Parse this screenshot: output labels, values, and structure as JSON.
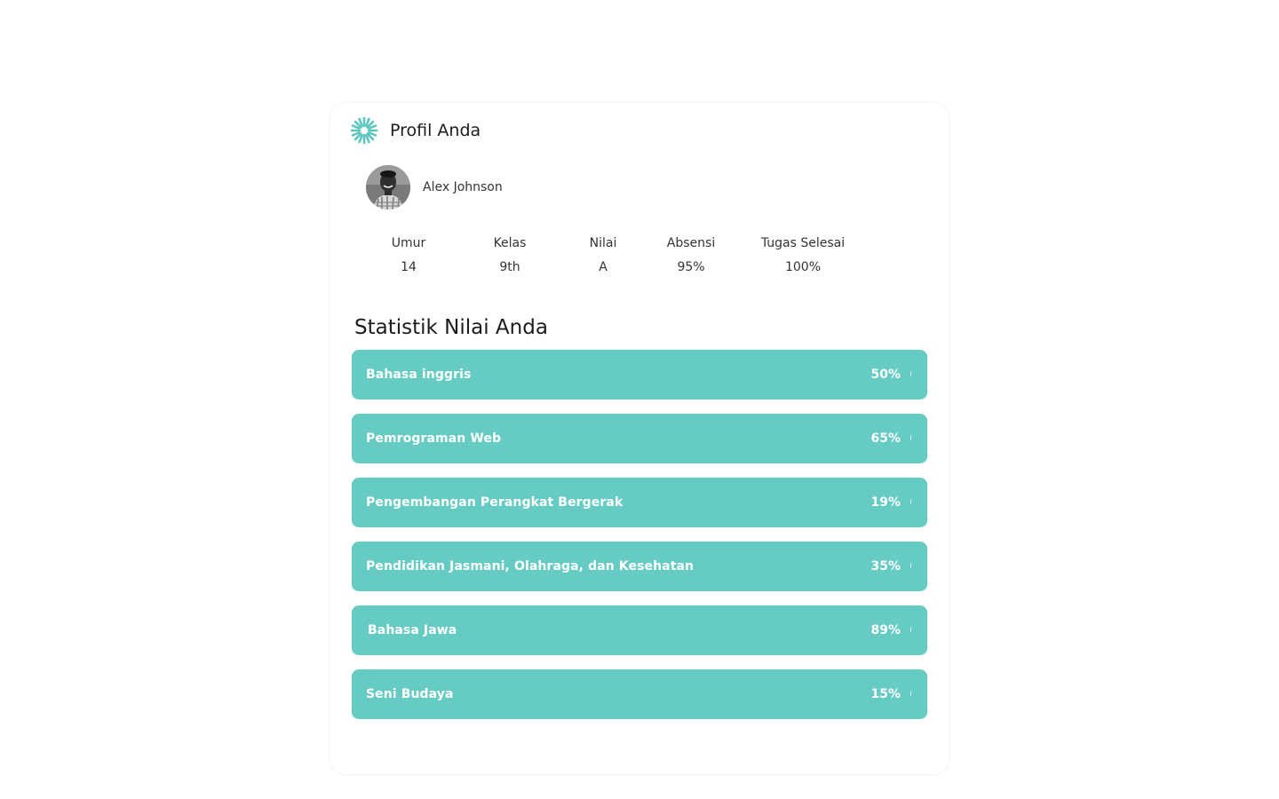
{
  "header": {
    "title": "Profil Anda",
    "logo_icon": "teal-sunburst-logo-icon"
  },
  "user": {
    "name": "Alex Johnson",
    "avatar_icon": "user-avatar"
  },
  "stats": [
    {
      "label": "Umur",
      "value": "14"
    },
    {
      "label": "Kelas",
      "value": "9th"
    },
    {
      "label": "Nilai",
      "value": "A"
    },
    {
      "label": "Absensi",
      "value": "95%"
    },
    {
      "label": "Tugas Selesai",
      "value": "100%"
    }
  ],
  "statistics": {
    "title": "Statistik Nilai Anda",
    "bar_color": "#66cbc3",
    "subjects": [
      {
        "name": "Bahasa inggris",
        "score": "50%"
      },
      {
        "name": "Pemrograman Web",
        "score": "65%"
      },
      {
        "name": "Pengembangan Perangkat Bergerak",
        "score": "19%"
      },
      {
        "name": "Pendidikan Jasmani, Olahraga, dan Kesehatan",
        "score": "35%"
      },
      {
        "name": "Bahasa Jawa",
        "score": "89%"
      },
      {
        "name": "Seni Budaya",
        "score": "15%"
      }
    ]
  }
}
